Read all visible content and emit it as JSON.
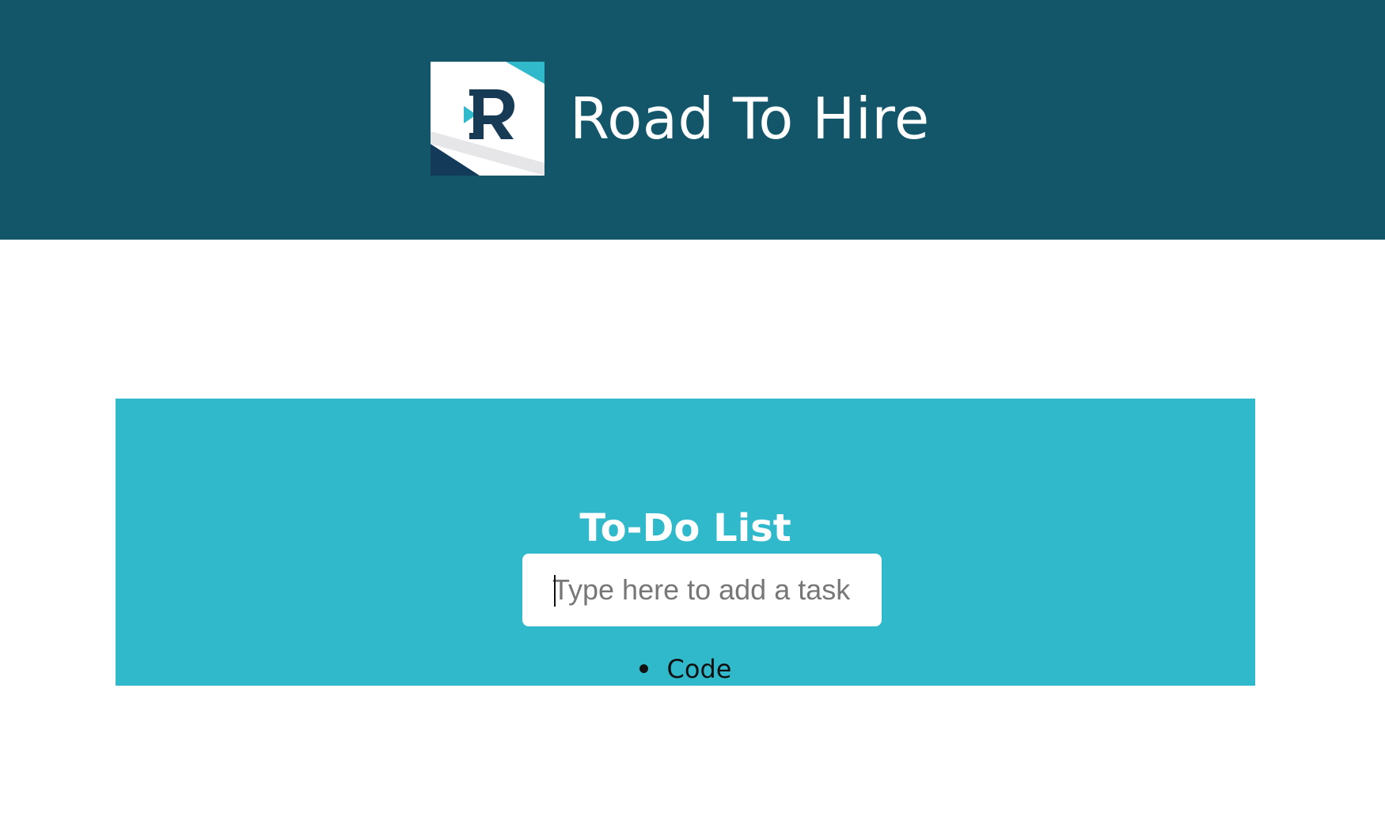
{
  "header": {
    "brand_name": "Road To Hire",
    "logo_icon": "road-to-hire-logo",
    "background_color": "#13566a"
  },
  "todo": {
    "title": "To-Do List",
    "input": {
      "value": "",
      "placeholder": "Type here to add a task"
    },
    "items": [
      {
        "label": "Code"
      }
    ],
    "panel_color": "#2fb9cb"
  }
}
